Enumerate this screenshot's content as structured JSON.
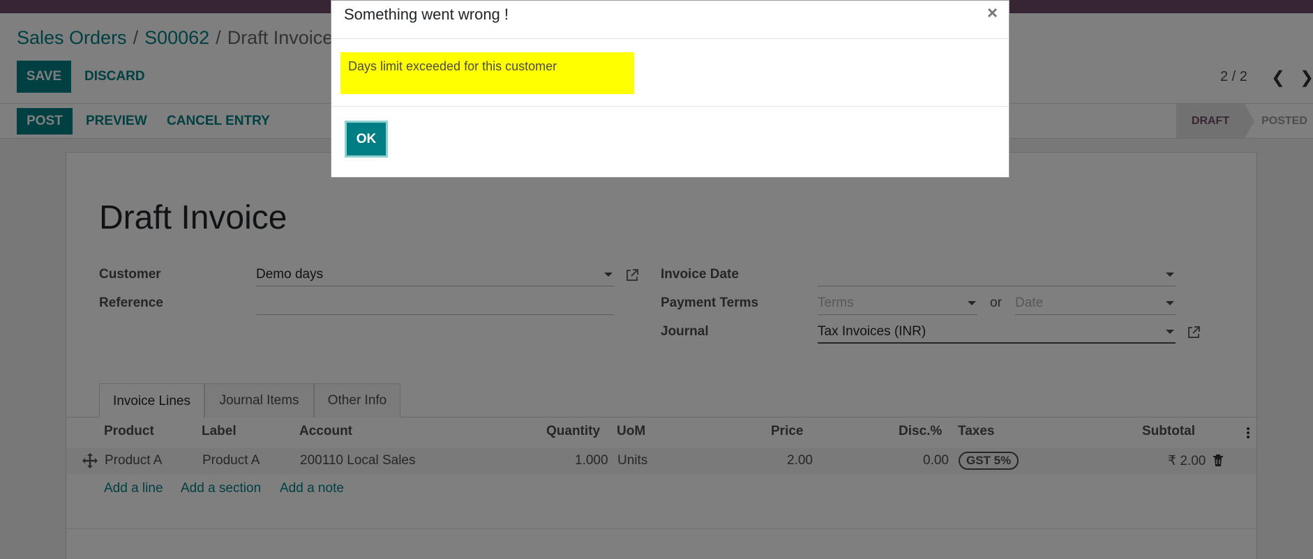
{
  "breadcrumb": {
    "root": "Sales Orders",
    "order": "S00062",
    "current": "Draft Invoice"
  },
  "form_buttons": {
    "save": "SAVE",
    "discard": "DISCARD"
  },
  "pager": {
    "value": "2 / 2"
  },
  "actions": {
    "post": "POST",
    "preview": "PREVIEW",
    "cancel_entry": "CANCEL ENTRY"
  },
  "status": {
    "draft": "DRAFT",
    "posted": "POSTED"
  },
  "document": {
    "title": "Draft Invoice"
  },
  "fields": {
    "customer_label": "Customer",
    "customer_value": "Demo days",
    "reference_label": "Reference",
    "reference_value": "",
    "invoice_date_label": "Invoice Date",
    "invoice_date_value": "",
    "payment_terms_label": "Payment Terms",
    "terms_placeholder": "Terms",
    "or_text": "or",
    "date_placeholder": "Date",
    "journal_label": "Journal",
    "journal_value": "Tax Invoices (INR)"
  },
  "tabs": [
    {
      "label": "Invoice Lines"
    },
    {
      "label": "Journal Items"
    },
    {
      "label": "Other Info"
    }
  ],
  "lines": {
    "headers": [
      "Product",
      "Label",
      "Account",
      "Quantity",
      "UoM",
      "Price",
      "Disc.%",
      "Taxes",
      "Subtotal"
    ],
    "rows": [
      {
        "product": "Product A",
        "label": "Product A",
        "account": "200110 Local Sales",
        "quantity": "1.000",
        "uom": "Units",
        "price": "2.00",
        "discount": "0.00",
        "taxes": "GST 5%",
        "subtotal": "₹ 2.00"
      }
    ],
    "add_line": "Add a line",
    "add_section": "Add a section",
    "add_note": "Add a note"
  },
  "dialog": {
    "title": "Something went wrong !",
    "close": "×",
    "message": "Days limit exceeded for this customer",
    "ok": "OK"
  },
  "colors": {
    "brand": "#714b67",
    "primary": "#017e84",
    "highlight": "#ffff00"
  }
}
